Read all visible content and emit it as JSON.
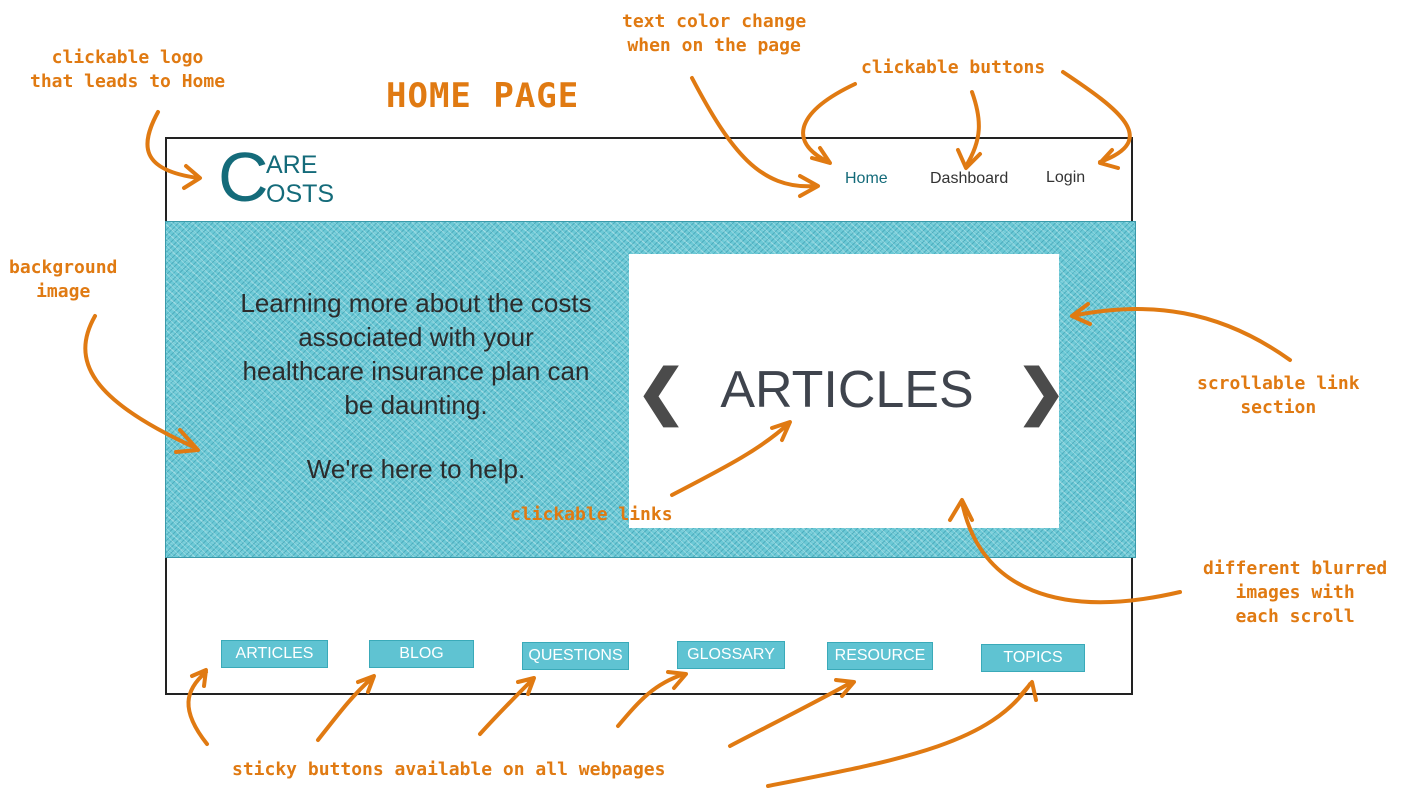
{
  "title": "HOME PAGE",
  "annotations": {
    "logo": "clickable logo\nthat leads to Home",
    "text_color": "text color change\nwhen on the page",
    "buttons": "clickable buttons",
    "background": "background\nimage",
    "scroll": "scrollable link\nsection",
    "links": "clickable links",
    "blurred": "different blurred\nimages with\neach scroll",
    "sticky": "sticky buttons available on all webpages"
  },
  "logo": {
    "c": "C",
    "line1": "ARE",
    "line2": "OSTS"
  },
  "nav": {
    "home": "Home",
    "dashboard": "Dashboard",
    "login": "Login"
  },
  "hero": {
    "text": "Learning more about the costs associated with your healthcare insurance plan can be daunting.",
    "help": "We're here to help."
  },
  "carousel": {
    "label": "ARTICLES",
    "prev": "❮",
    "next": "❯"
  },
  "sticky_buttons": [
    "ARTICLES",
    "BLOG",
    "QUESTIONS",
    "GLOSSARY",
    "RESOURCE",
    "TOPICS"
  ],
  "colors": {
    "annotation": "#e07a12",
    "brand": "#146b7a",
    "hero": "#6cc9d6",
    "button": "#5fc3d2"
  }
}
